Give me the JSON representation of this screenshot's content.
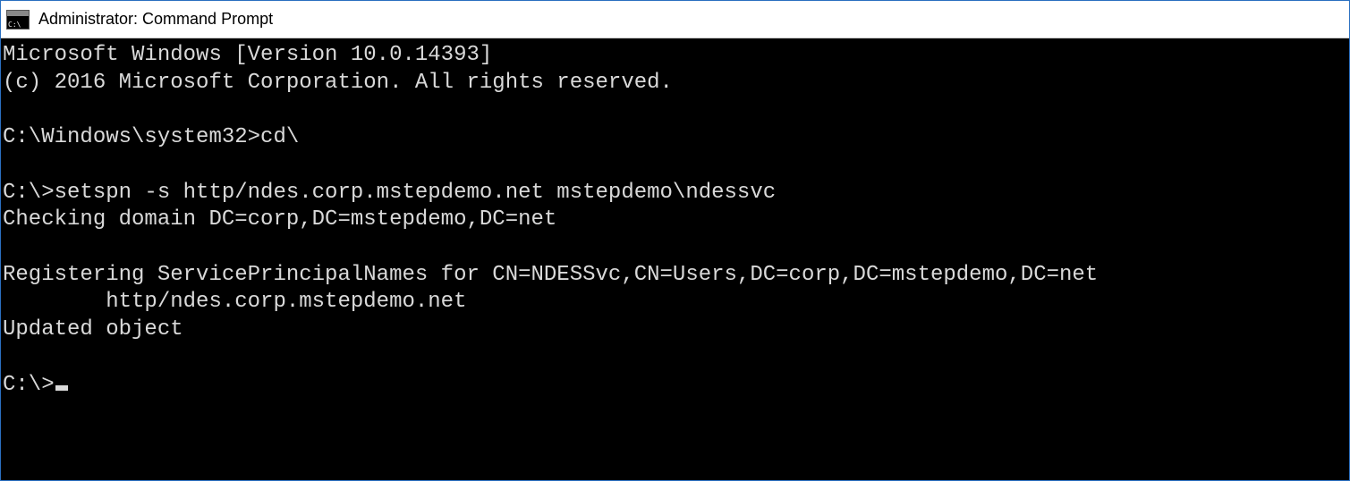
{
  "window": {
    "title": "Administrator: Command Prompt"
  },
  "terminal": {
    "lines": [
      "Microsoft Windows [Version 10.0.14393]",
      "(c) 2016 Microsoft Corporation. All rights reserved.",
      "",
      "C:\\Windows\\system32>cd\\",
      "",
      "C:\\>setspn -s http/ndes.corp.mstepdemo.net mstepdemo\\ndessvc",
      "Checking domain DC=corp,DC=mstepdemo,DC=net",
      "",
      "Registering ServicePrincipalNames for CN=NDESSvc,CN=Users,DC=corp,DC=mstepdemo,DC=net",
      "        http/ndes.corp.mstepdemo.net",
      "Updated object",
      ""
    ],
    "prompt": "C:\\>"
  }
}
